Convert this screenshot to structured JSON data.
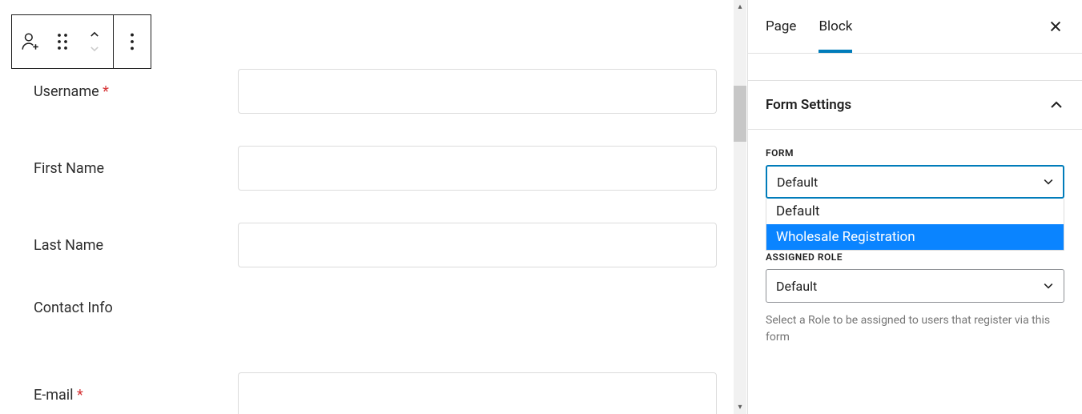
{
  "toolbar": {
    "block_icon": "user-plus-icon",
    "drag_icon": "drag-handle-icon",
    "move_up": "chevron-up",
    "move_down": "chevron-down",
    "options_icon": "options-icon"
  },
  "form": {
    "fields": {
      "username": {
        "label": "Username",
        "required": true
      },
      "first_name": {
        "label": "First Name",
        "required": false
      },
      "last_name": {
        "label": "Last Name",
        "required": false
      },
      "email": {
        "label": "E-mail",
        "required": true
      }
    },
    "section_contact": "Contact Info"
  },
  "sidebar": {
    "tabs": {
      "page": "Page",
      "block": "Block"
    },
    "panel_title": "Form Settings",
    "form_select": {
      "label": "FORM",
      "selected": "Default",
      "options": [
        "Default",
        "Wholesale Registration"
      ]
    },
    "role_select": {
      "label": "ASSIGNED ROLE",
      "selected": "Default",
      "help": "Select a Role to be assigned to users that register via this form"
    }
  }
}
